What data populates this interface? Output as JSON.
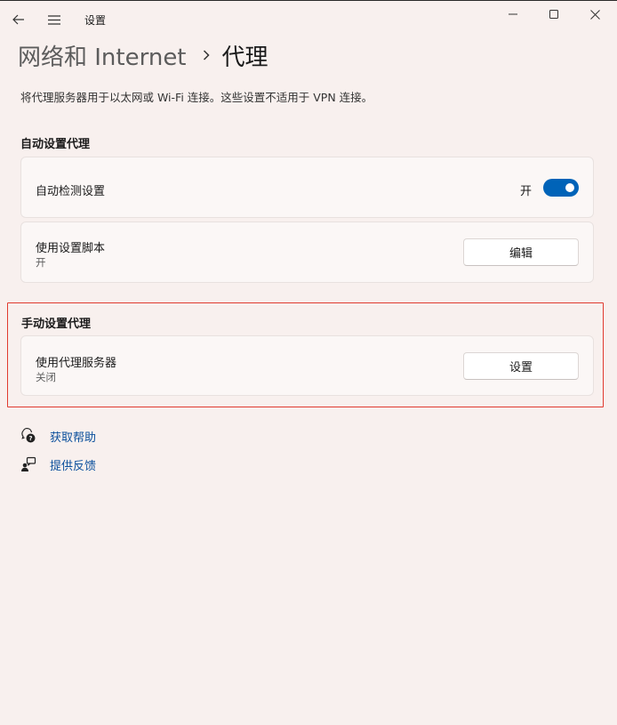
{
  "window": {
    "title": "设置",
    "back_icon": "back-arrow-icon",
    "menu_icon": "hamburger-icon"
  },
  "header": {
    "parent": "网络和 Internet",
    "current": "代理"
  },
  "description": "将代理服务器用于以太网或 Wi-Fi 连接。这些设置不适用于 VPN 连接。",
  "auto_section": {
    "title": "自动设置代理",
    "auto_detect": {
      "label": "自动检测设置",
      "state_label": "开",
      "toggle_on": true
    },
    "setup_script": {
      "label": "使用设置脚本",
      "status": "开",
      "button_label": "编辑"
    }
  },
  "manual_section": {
    "title": "手动设置代理",
    "proxy_server": {
      "label": "使用代理服务器",
      "status": "关闭",
      "button_label": "设置"
    }
  },
  "links": {
    "help": "获取帮助",
    "feedback": "提供反馈"
  },
  "colors": {
    "accent": "#0063b8",
    "highlight_box": "#e03a2f",
    "link": "#0a4f9c"
  }
}
